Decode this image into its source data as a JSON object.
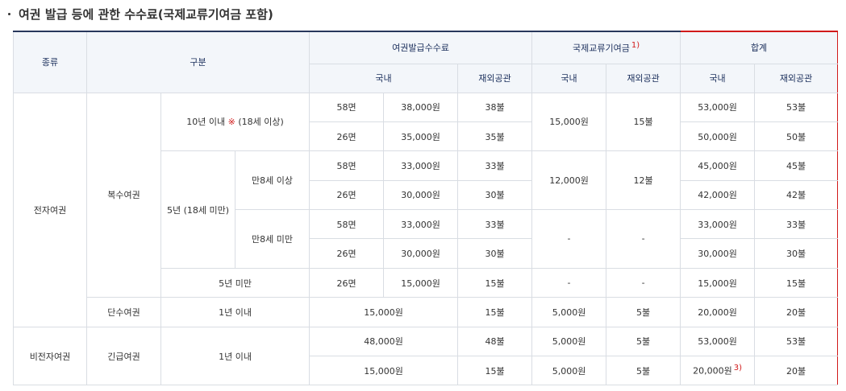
{
  "heading": "여권 발급 등에 관한 수수료(국제교류기여금 포함)",
  "header": {
    "kind": "종류",
    "category": "구분",
    "issue_fee": "여권발급수수료",
    "contribution": "국제교류기여금",
    "contribution_note": "1)",
    "total": "합계",
    "domestic": "국내",
    "overseas": "재외공관"
  },
  "rows": {
    "electronic": "전자여권",
    "non_electronic": "비전자여권",
    "multiple": "복수여권",
    "single": "단수여권",
    "emergency": "긴급여권",
    "ten_year_prefix": "10년 이내 ",
    "ten_year_mark": "※",
    "ten_year_suffix": " (18세 이상)",
    "five_year_minor": "5년 (18세 미만)",
    "age8_over": "만8세 이상",
    "age8_under": "만8세 미만",
    "under5": "5년 미만",
    "within1": "1년 이내"
  },
  "cells": {
    "r1": {
      "pages": "58면",
      "dom": "38,000원",
      "ovs": "38불",
      "c_dom": "15,000원",
      "c_ovs": "15불",
      "t_dom": "53,000원",
      "t_ovs": "53불"
    },
    "r2": {
      "pages": "26면",
      "dom": "35,000원",
      "ovs": "35불",
      "t_dom": "50,000원",
      "t_ovs": "50불"
    },
    "r3": {
      "pages": "58면",
      "dom": "33,000원",
      "ovs": "33불",
      "c_dom": "12,000원",
      "c_ovs": "12불",
      "t_dom": "45,000원",
      "t_ovs": "45불"
    },
    "r4": {
      "pages": "26면",
      "dom": "30,000원",
      "ovs": "30불",
      "t_dom": "42,000원",
      "t_ovs": "42불"
    },
    "r5": {
      "pages": "58면",
      "dom": "33,000원",
      "ovs": "33불",
      "c_dom": "-",
      "c_ovs": "-",
      "t_dom": "33,000원",
      "t_ovs": "33불"
    },
    "r6": {
      "pages": "26면",
      "dom": "30,000원",
      "ovs": "30불",
      "t_dom": "30,000원",
      "t_ovs": "30불"
    },
    "r7": {
      "pages": "26면",
      "dom": "15,000원",
      "ovs": "15불",
      "c_dom": "-",
      "c_ovs": "-",
      "t_dom": "15,000원",
      "t_ovs": "15불"
    },
    "r8": {
      "dom": "15,000원",
      "ovs": "15불",
      "c_dom": "5,000원",
      "c_ovs": "5불",
      "t_dom": "20,000원",
      "t_ovs": "20불"
    },
    "r9": {
      "dom": "48,000원",
      "ovs": "48불",
      "c_dom": "5,000원",
      "c_ovs": "5불",
      "t_dom": "53,000원",
      "t_ovs": "53불"
    },
    "r10": {
      "dom": "15,000원",
      "ovs": "15불",
      "c_dom": "5,000원",
      "c_ovs": "5불",
      "t_dom": "20,000원",
      "t_dom_note": "3)",
      "t_ovs": "20불"
    }
  },
  "colors": {
    "header_bg": "#f3f6fa",
    "header_text": "#1b2f5c",
    "accent_red": "#d11a1a",
    "border": "#d9dde3"
  }
}
